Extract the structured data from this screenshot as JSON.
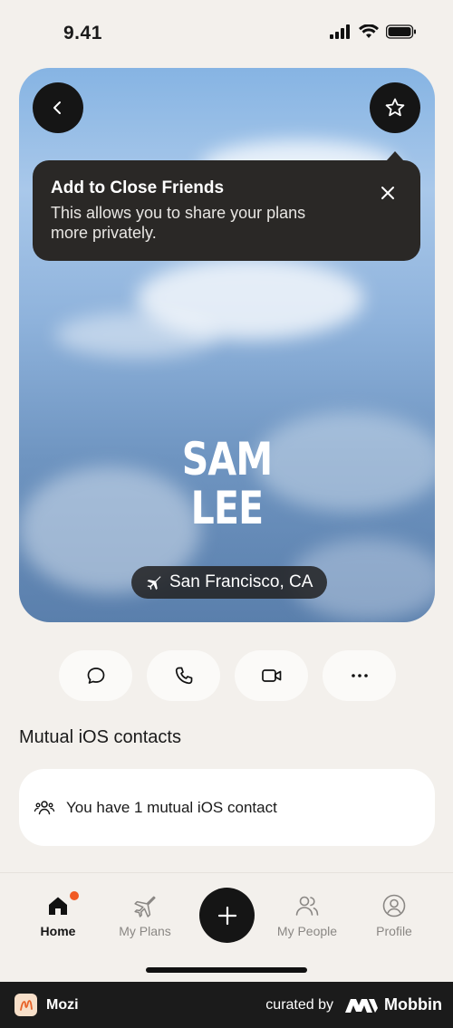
{
  "status_bar": {
    "time": "9.41"
  },
  "hero": {
    "first_name": "SAM",
    "last_name": "LEE",
    "location": "San Francisco, CA"
  },
  "tooltip": {
    "title": "Add to Close Friends",
    "body": "This allows you to share your plans more privately."
  },
  "actions": [
    "message-icon",
    "phone-icon",
    "video-icon",
    "more-icon"
  ],
  "mutual": {
    "section_title": "Mutual iOS contacts",
    "text": "You have 1 mutual iOS contact"
  },
  "tabbar": {
    "home": "Home",
    "my_plans": "My Plans",
    "my_people": "My People",
    "profile": "Profile"
  },
  "footer": {
    "app_name": "Mozi",
    "curated_by": "curated by",
    "brand": "Mobbin"
  },
  "colors": {
    "badge": "#f15a24",
    "dark": "#151515",
    "background": "#f3f0ec"
  }
}
